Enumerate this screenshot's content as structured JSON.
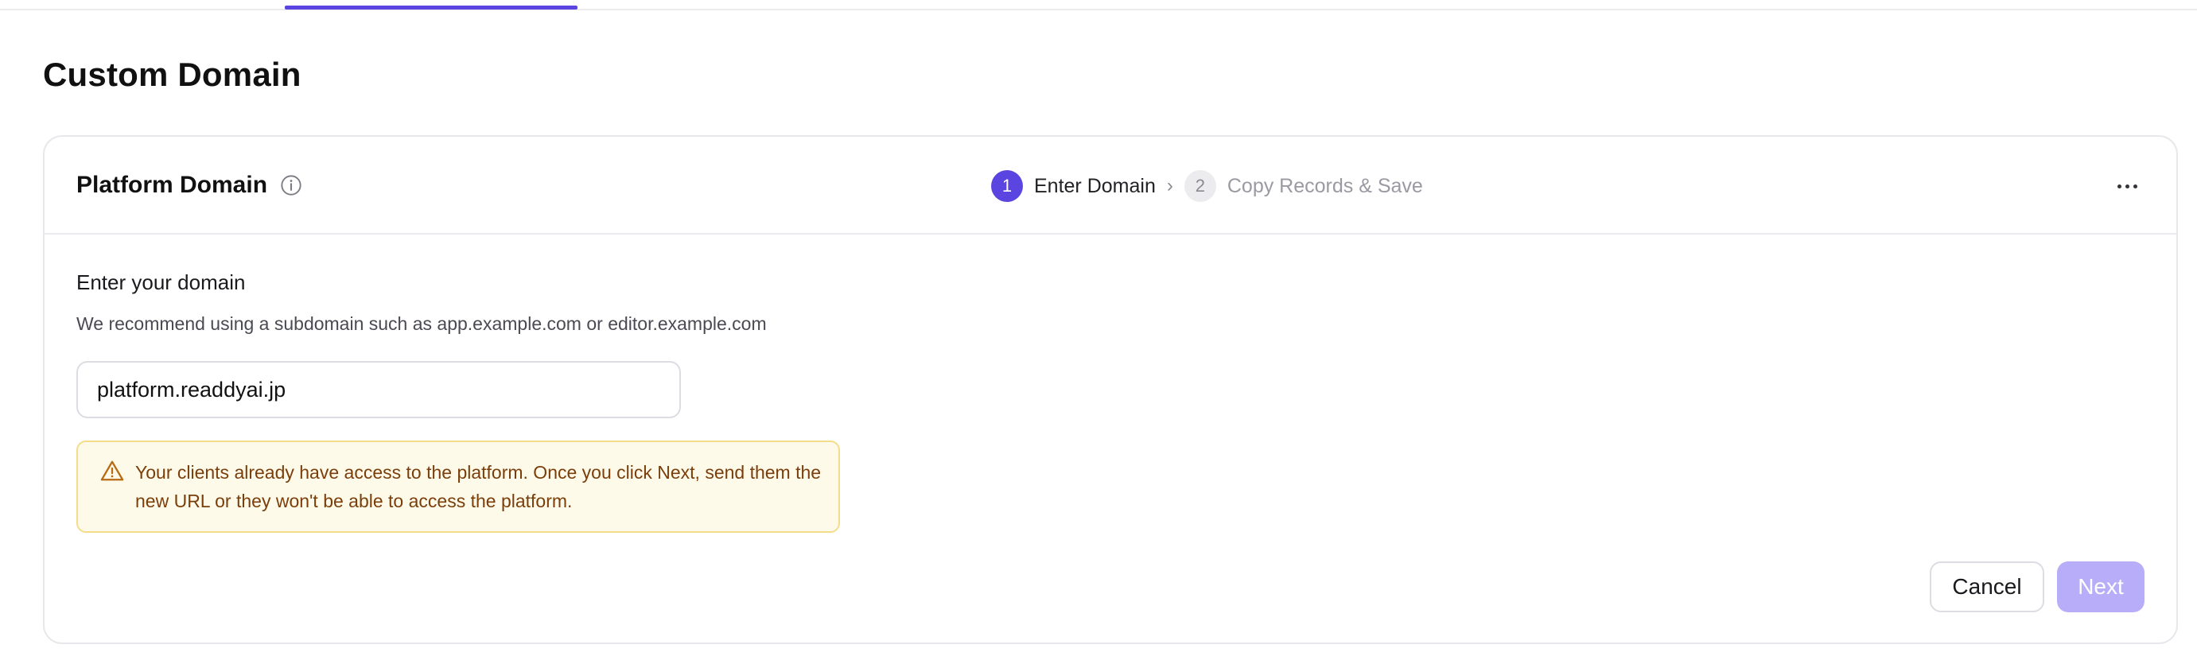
{
  "page": {
    "title": "Custom Domain"
  },
  "card": {
    "title": "Platform Domain",
    "stepper": {
      "steps": [
        {
          "number": "1",
          "label": "Enter Domain",
          "state": "active"
        },
        {
          "number": "2",
          "label": "Copy Records & Save",
          "state": "inactive"
        }
      ],
      "separator": "›"
    },
    "form": {
      "label": "Enter your domain",
      "help": "We recommend using a subdomain such as app.example.com or editor.example.com",
      "domain_value": "platform.readdyai.jp"
    },
    "warning": {
      "text": "Your clients already have access to the platform. Once you click Next, send them the new URL or they won't be able to access the platform."
    },
    "actions": {
      "cancel_label": "Cancel",
      "next_label": "Next"
    }
  },
  "colors": {
    "accent": "#5b45e0",
    "next_disabled": "#b8adf8",
    "warning_bg": "#fefaea",
    "warning_border": "#f4dd8a",
    "warning_text": "#7a3e0a"
  },
  "icons": {
    "info": "info-icon",
    "more": "more-horizontal-icon",
    "warning": "warning-triangle-icon"
  }
}
